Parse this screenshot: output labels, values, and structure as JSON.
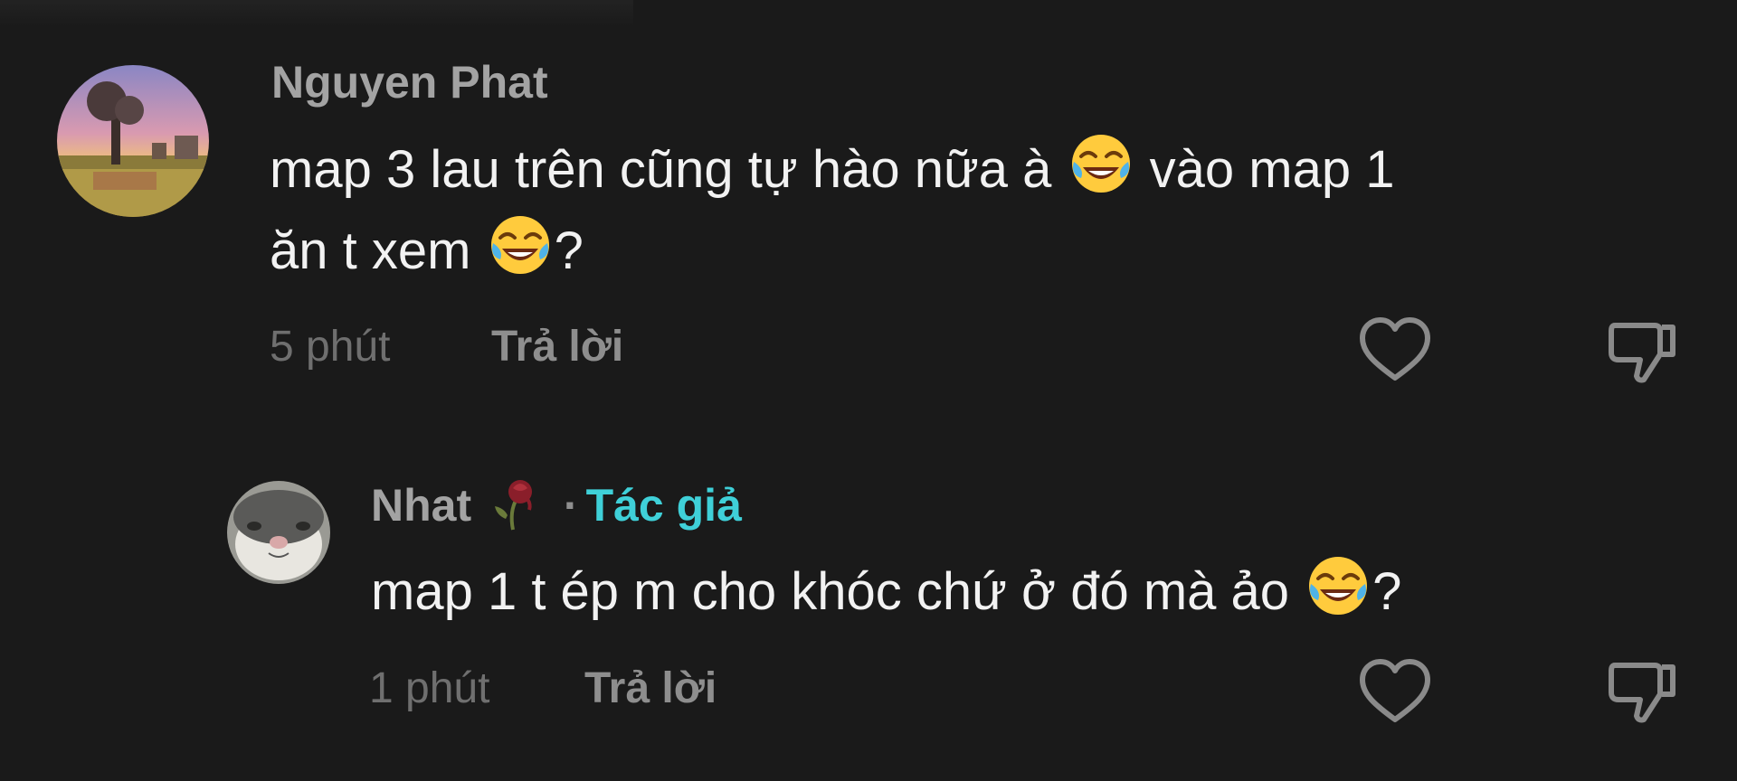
{
  "comments": [
    {
      "username": "Nguyen Phat",
      "text_line1_a": "map 3 lau trên cũng tự hào nữa à",
      "text_line1_b": "vào map 1",
      "text_line2_a": "ăn t xem",
      "text_line2_b": "?",
      "time": "5 phút",
      "reply_label": "Trả lời"
    },
    {
      "username": "Nhat",
      "separator": "·",
      "author_badge": "Tác giả",
      "text_a": "map 1 t ép m cho khóc chứ ở đó mà ảo",
      "text_b": "?",
      "time": "1 phút",
      "reply_label": "Trả lời"
    }
  ],
  "icons": {
    "like": "heart-outline-icon",
    "dislike": "thumbs-down-outline-icon",
    "laugh": "face-with-tears-of-joy-emoji",
    "rose": "wilted-flower-emoji"
  },
  "colors": {
    "background": "#1a1a1a",
    "username": "#a3a3a3",
    "text": "#f2f2f2",
    "meta": "#6f6f6f",
    "author_badge": "#3fd0d8"
  }
}
